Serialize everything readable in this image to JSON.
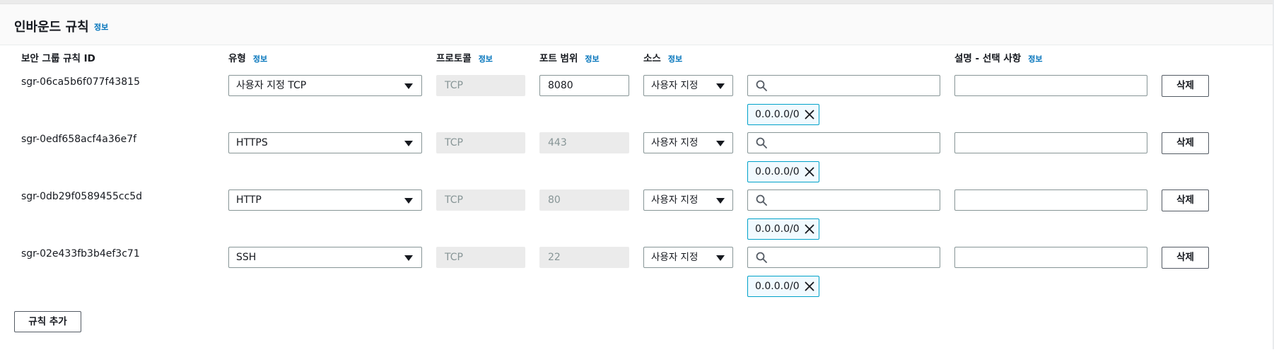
{
  "panel": {
    "title": "인바운드 규칙",
    "info_label": "정보"
  },
  "columns": {
    "rule_id": "보안 그룹 규칙 ID",
    "type": "유형",
    "protocol": "프로토콜",
    "port_range": "포트 범위",
    "source": "소스",
    "description": "설명 - 선택 사항",
    "info_label": "정보"
  },
  "rules": [
    {
      "id": "sgr-06ca5b6f077f43815",
      "type": "사용자 지정 TCP",
      "protocol": "TCP",
      "port": "8080",
      "port_editable": true,
      "source": "사용자 지정",
      "search_value": "",
      "cidr": "0.0.0.0/0",
      "description": "",
      "delete_label": "삭제"
    },
    {
      "id": "sgr-0edf658acf4a36e7f",
      "type": "HTTPS",
      "protocol": "TCP",
      "port": "443",
      "port_editable": false,
      "source": "사용자 지정",
      "search_value": "",
      "cidr": "0.0.0.0/0",
      "description": "",
      "delete_label": "삭제"
    },
    {
      "id": "sgr-0db29f0589455cc5d",
      "type": "HTTP",
      "protocol": "TCP",
      "port": "80",
      "port_editable": false,
      "source": "사용자 지정",
      "search_value": "",
      "cidr": "0.0.0.0/0",
      "description": "",
      "delete_label": "삭제"
    },
    {
      "id": "sgr-02e433fb3b4ef3c71",
      "type": "SSH",
      "protocol": "TCP",
      "port": "22",
      "port_editable": false,
      "source": "사용자 지정",
      "search_value": "",
      "cidr": "0.0.0.0/0",
      "description": "",
      "delete_label": "삭제"
    }
  ],
  "add_rule_label": "규칙 추가",
  "icons": {
    "dropdown": "caret-down-icon",
    "search": "search-icon",
    "remove": "close-icon"
  },
  "colors": {
    "link": "#0073bb",
    "token_border": "#00a1c9",
    "token_background": "#f1faff",
    "disabled_field": "#ebebeb",
    "header_background": "#fafafa"
  }
}
